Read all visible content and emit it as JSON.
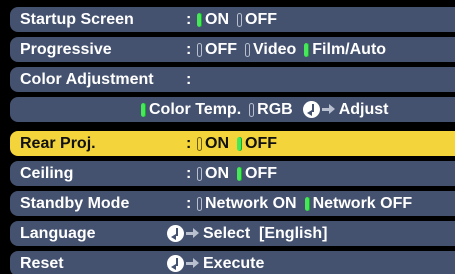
{
  "menu": {
    "rows": [
      {
        "label": "Startup Screen",
        "colon": ":",
        "options": [
          {
            "text": "ON",
            "selected": true
          },
          {
            "text": "OFF",
            "selected": false
          }
        ]
      },
      {
        "label": "Progressive",
        "colon": ":",
        "options": [
          {
            "text": "OFF",
            "selected": false
          },
          {
            "text": "Video",
            "selected": false
          },
          {
            "text": "Film/Auto",
            "selected": true
          }
        ]
      },
      {
        "label": "Color Adjustment",
        "colon": ":"
      },
      {
        "options": [
          {
            "text": "Color Temp.",
            "selected": true
          },
          {
            "text": "RGB",
            "selected": false
          }
        ],
        "action": "Adjust"
      },
      {
        "label": "Rear Proj.",
        "colon": ":",
        "highlighted": true,
        "options": [
          {
            "text": "ON",
            "selected": false
          },
          {
            "text": "OFF",
            "selected": true
          }
        ]
      },
      {
        "label": "Ceiling",
        "colon": ":",
        "options": [
          {
            "text": "ON",
            "selected": false
          },
          {
            "text": "OFF",
            "selected": true
          }
        ]
      },
      {
        "label": "Standby Mode",
        "colon": ":",
        "options": [
          {
            "text": "Network ON",
            "selected": false
          },
          {
            "text": "Network OFF",
            "selected": true
          }
        ]
      },
      {
        "label": "Language",
        "action": "Select  [English]"
      },
      {
        "label": "Reset",
        "action": "Execute"
      }
    ]
  },
  "colors": {
    "row_background": "#44526f",
    "highlight": "#f3d53b",
    "indicator_on": "#46e85a",
    "text": "#ffffff"
  },
  "icons": {
    "enter": "enter-icon",
    "arrow": "arrow-right-icon",
    "indicator": "indicator-icon"
  }
}
